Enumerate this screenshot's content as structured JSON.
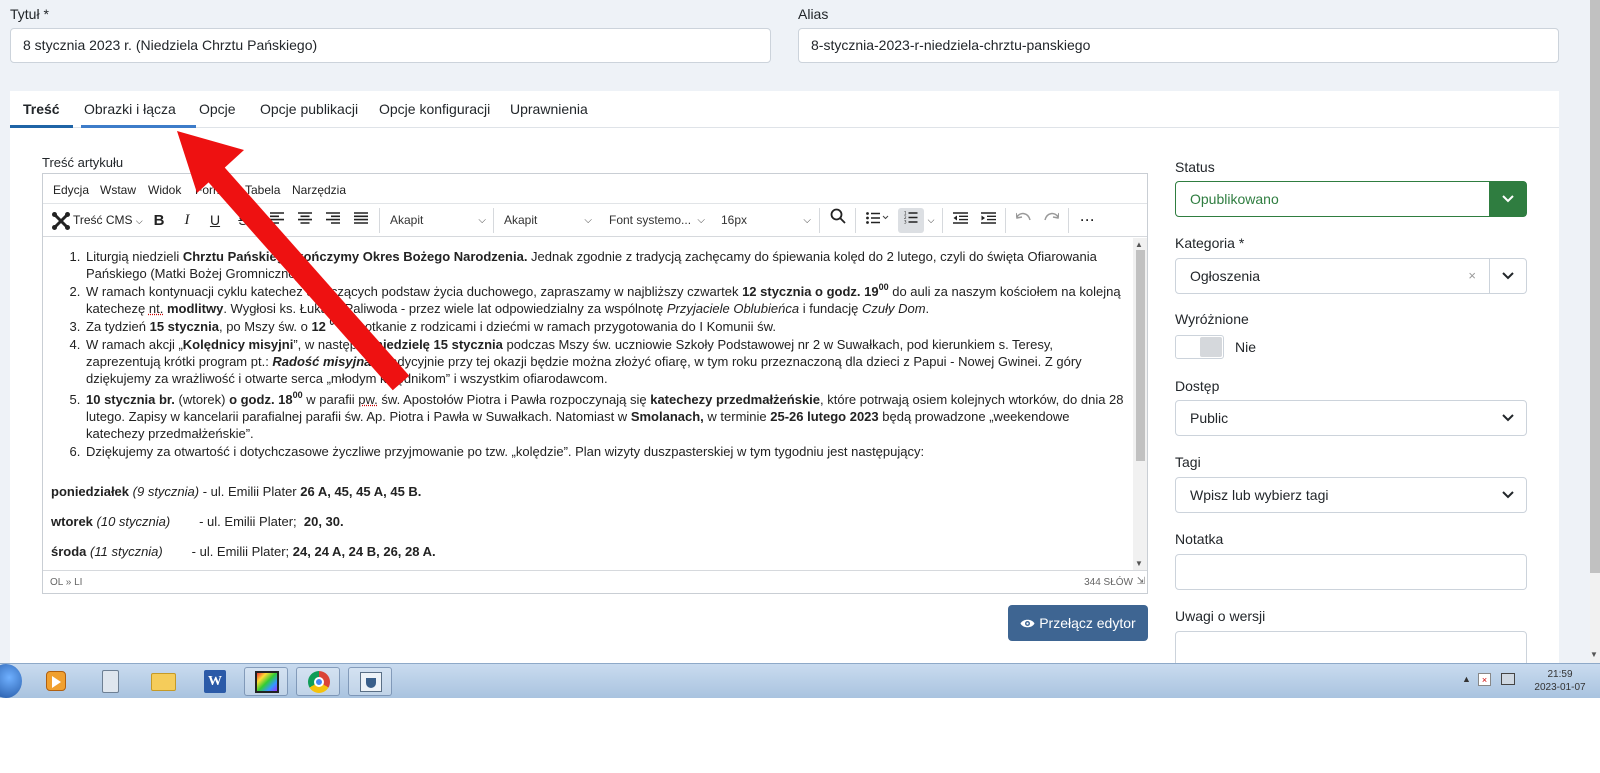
{
  "form": {
    "title_label": "Tytuł *",
    "title_value": "8 stycznia 2023 r. (Niedziela Chrztu Pańskiego)",
    "alias_label": "Alias",
    "alias_value": "8-stycznia-2023-r-niedziela-chrztu-panskiego"
  },
  "tabs": [
    {
      "label": "Treść"
    },
    {
      "label": "Obrazki i łącza"
    },
    {
      "label": "Opcje"
    },
    {
      "label": "Opcje publikacji"
    },
    {
      "label": "Opcje konfiguracji"
    },
    {
      "label": "Uprawnienia"
    }
  ],
  "editor": {
    "label": "Treść artykułu",
    "menu": [
      "Edycja",
      "Wstaw",
      "Widok",
      "Format",
      "Tabela",
      "Narzędzia"
    ],
    "toolbar": {
      "cms_label": "Treść CMS",
      "bold": "B",
      "italic": "I",
      "underline": "U",
      "strike": "S",
      "block1": "Akapit",
      "block2": "Akapit",
      "font": "Font systemo...",
      "size": "16px"
    },
    "content": {
      "li1_a": "Liturgią niedzieli ",
      "li1_b": "Chrztu Pańskiego kończymy Okres Bożego Narodzenia.",
      "li1_c": " Jednak zgodnie z tradycją zachęcamy do śpiewania kolęd do 2 lutego, czyli do święta Ofiarowania Pańskiego (Matki Bożej Gromnicznej).",
      "li2_a": "W ramach kontynuacji cyklu katechez dotyczących podstaw życia duchowego, zapraszamy w najbliższy czwartek ",
      "li2_b": "12 stycznia o godz. 19",
      "li2_sup": "00",
      "li2_c": " do auli za naszym kościołem na kolejną katechezę ",
      "li2_d": "nt.",
      "li2_e": " ",
      "li2_f": "modlitwy",
      "li2_g": ". Wygłosi ks. Łukasz Paliwoda - przez wiele lat odpowiedzialny za wspólnotę ",
      "li2_h": "Przyjaciele Oblubieńca",
      "li2_i": " i fundację ",
      "li2_j": "Czuły Dom",
      "li2_k": ".",
      "li3_a": "Za tydzień ",
      "li3_b": "15 stycznia",
      "li3_c": ", po Mszy św. o ",
      "li3_d": "12 ",
      "li3_sup": "00",
      "li3_e": " - spotkanie z rodzicami i dziećmi w ramach przygotowania do I Komunii św.",
      "li4_a": "W ramach akcji „",
      "li4_b": "Kolędnicy misyjni",
      "li4_c": "”, w następną ",
      "li4_d": "niedzielę 15 stycznia",
      "li4_e": " podczas Mszy św. uczniowie Szkoły Podstawowej nr 2 w Suwałkach, pod kierunkiem s. Teresy, zaprezentują krótki program pt.: ",
      "li4_f": "Radość misyjna",
      "li4_g": ". Tradycyjnie przy tej okazji będzie można złożyć ofiarę, w tym roku przeznaczoną dla dzieci z Papui - Nowej Gwinei. Z góry dziękujemy za wrażliwość i otwarte serca „młodym kolędnikom” i wszystkim ofiarodawcom.",
      "li5_a": "10 stycznia br.",
      "li5_b": " (wtorek) ",
      "li5_c": "o godz. 18",
      "li5_sup": "00",
      "li5_d": " w parafii ",
      "li5_e": "pw.",
      "li5_f": " św. Apostołów Piotra i Pawła rozpoczynają się ",
      "li5_g": "katechezy przedmałżeńskie",
      "li5_h": ", które potrwają osiem kolejnych wtorków, do dnia 28 lutego. Zapisy w kancelarii parafialnej parafii św. Ap. Piotra i Pawła w Suwałkach. Natomiast w ",
      "li5_i": "Smolanach,",
      "li5_j": " w terminie ",
      "li5_k": "25-26 lutego 2023",
      "li5_l": " będą prowadzone „weekendowe katechezy przedmałżeńskie”.",
      "li6": "Dziękujemy za otwartość i dotychczasowe życzliwe przyjmowanie po tzw. „kolędzie”. Plan wizyty duszpasterskiej w tym tygodniu jest następujący:",
      "p1_a": "poniedziałek",
      "p1_b": " (9 stycznia)",
      "p1_c": " - ul. Emilii Plater ",
      "p1_d": "26 A, 45, 45 A, 45 B.",
      "p2_a": "wtorek",
      "p2_b": " (10 stycznia)",
      "p2_c": "        - ul. Emilii Plater;  ",
      "p2_d": "20, 30.",
      "p3_a": "środa",
      "p3_b": " (11 stycznia)",
      "p3_c": "        - ul. Emilii Plater; ",
      "p3_d": "24, 24 A, 24 B, 26, 28 A."
    },
    "path": "OL » LI",
    "word_count": "344 SŁÓW"
  },
  "switch_button": "Przełącz edytor",
  "sidebar": {
    "status_label": "Status",
    "status_value": "Opublikowano",
    "category_label": "Kategoria *",
    "category_value": "Ogłoszenia",
    "featured_label": "Wyróżnione",
    "featured_value": "Nie",
    "access_label": "Dostęp",
    "access_value": "Public",
    "tags_label": "Tagi",
    "tags_placeholder": "Wpisz lub wybierz tagi",
    "note_label": "Notatka",
    "version_label": "Uwagi o wersji"
  },
  "taskbar": {
    "time": "21:59",
    "date": "2023-01-07"
  },
  "colors": {
    "accent": "#1f64a6",
    "published_green": "#2f7d40",
    "button_blue": "#3e6592",
    "annotation_red": "#ee1111"
  }
}
